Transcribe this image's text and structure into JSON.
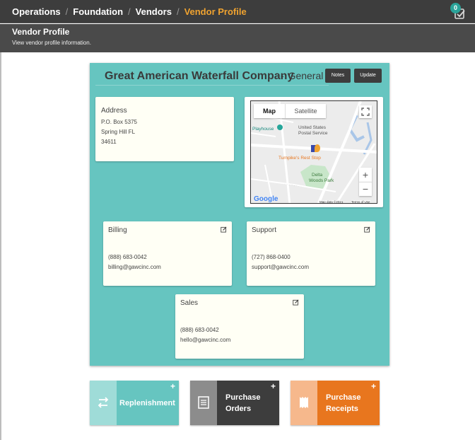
{
  "breadcrumb": {
    "items": [
      "Operations",
      "Foundation",
      "Vendors"
    ],
    "active": "Vendor Profile"
  },
  "notifications": {
    "count": "0",
    "icon": "checklist-icon"
  },
  "page": {
    "title": "Vendor Profile",
    "description": "View vendor profile information."
  },
  "vendor": {
    "name": "Great American Waterfall Company",
    "type_separator": "-",
    "type": "General",
    "notes_label": "Notes",
    "update_label": "Update"
  },
  "address": {
    "title": "Address",
    "lines": [
      "P.O. Box 5375",
      "Spring Hill FL",
      "34611"
    ]
  },
  "map": {
    "tab_map": "Map",
    "tab_satellite": "Satellite",
    "zoom_in": "+",
    "zoom_out": "−",
    "labels": {
      "playhouse": "Playhouse",
      "postal1": "United States",
      "postal2": "Postal Service",
      "rest_stop": "Turnpike's Rest Stop",
      "park1": "Delta",
      "park2": "Woods Park"
    },
    "google": "Google",
    "map_data": "Map data ©2021",
    "terms": "Terms of Use"
  },
  "contacts": {
    "billing": {
      "title": "Billing",
      "phone": "(888) 683-0042",
      "email": "billing@gawcinc.com"
    },
    "support": {
      "title": "Support",
      "phone": "(727) 868-0400",
      "email": "support@gawcinc.com"
    },
    "sales": {
      "title": "Sales",
      "phone": "(888) 683-0042",
      "email": "hello@gawcinc.com"
    }
  },
  "tiles": {
    "replenishment": {
      "label": "Replenishment",
      "icon": "transfer-arrows-icon",
      "color": "#66c5c0",
      "icon_bg": "#9fdcd8"
    },
    "purchase_orders": {
      "line1": "Purchase",
      "line2": "Orders",
      "icon": "document-list-icon",
      "color": "#3d3d3d",
      "icon_bg": "#8c8c8c"
    },
    "purchase_receipts": {
      "line1": "Purchase",
      "line2": "Receipts",
      "icon": "receipt-icon",
      "color": "#e8761e",
      "icon_bg": "#f6b88c"
    }
  },
  "colors": {
    "accent": "#f0a330",
    "panel": "#66c5c0",
    "header": "#3d3d3d"
  }
}
